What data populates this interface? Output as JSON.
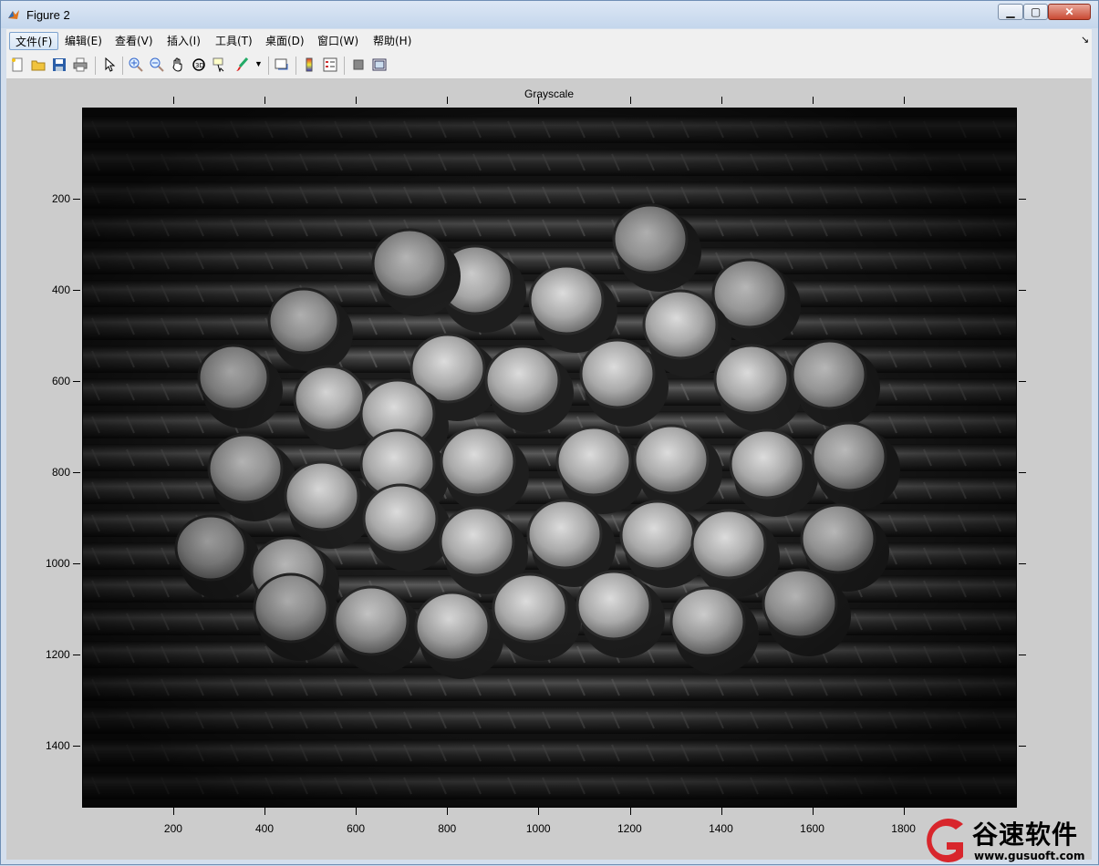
{
  "window": {
    "title": "Figure 2"
  },
  "menu": [
    {
      "label": "文件(F)",
      "active": true
    },
    {
      "label": "编辑(E)"
    },
    {
      "label": "查看(V)"
    },
    {
      "label": "插入(I)"
    },
    {
      "label": "工具(T)"
    },
    {
      "label": "桌面(D)"
    },
    {
      "label": "窗口(W)"
    },
    {
      "label": "帮助(H)"
    }
  ],
  "toolbar": {
    "icons": [
      "new-figure-icon",
      "open-file-icon",
      "save-icon",
      "print-icon",
      "pointer-icon",
      "zoom-in-icon",
      "zoom-out-icon",
      "pan-hand-icon",
      "rotate-3d-icon",
      "data-cursor-icon",
      "brush-icon",
      "brush-dropdown-icon",
      "link-plot-icon",
      "colorbar-icon",
      "legend-icon",
      "hide-plot-tools-icon",
      "show-plot-tools-icon"
    ]
  },
  "axes": {
    "title": "Grayscale",
    "xticks": [
      "200",
      "400",
      "600",
      "800",
      "1000",
      "1200",
      "1400",
      "1600",
      "1800"
    ],
    "yticks": [
      "200",
      "400",
      "600",
      "800",
      "1000",
      "1200",
      "1400"
    ],
    "image_description_icon": "grayscale-rebar-bundle-image"
  },
  "watermark": {
    "name": "谷速软件",
    "url": "www.gusuoft.com"
  },
  "colors": {
    "accent": "#c94a33",
    "figure_bg": "#cccccc",
    "plot_bg": "#111111",
    "watermark_red": "#d8262c"
  }
}
